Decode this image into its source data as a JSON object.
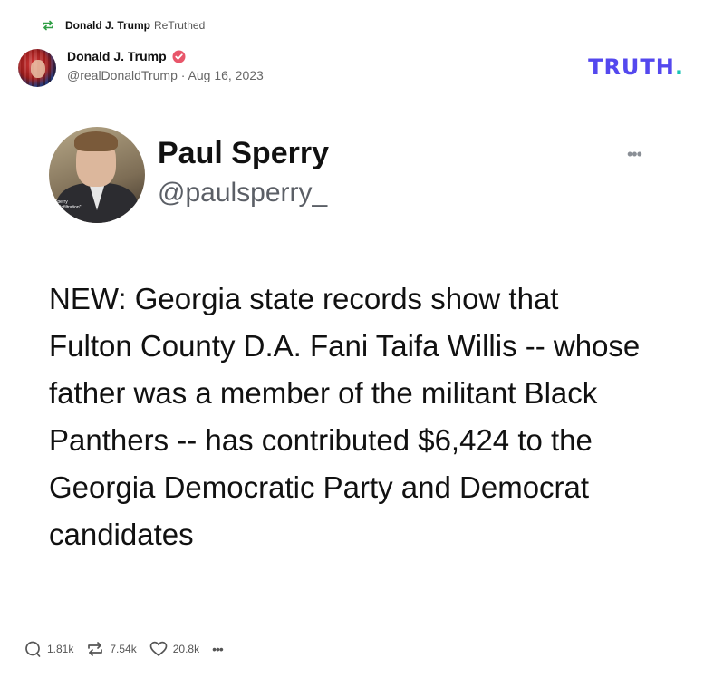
{
  "retruth": {
    "name": "Donald J. Trump",
    "suffix": "ReTruthed"
  },
  "post": {
    "author_name": "Donald J. Trump",
    "handle_date": "@realDonaldTrump · Aug 16, 2023",
    "verified": true
  },
  "brand": {
    "logo_text": "TRUTH",
    "logo_dot": ".",
    "accent": "#5448ee",
    "dot_color": "#18c4b5"
  },
  "embedded": {
    "name": "Paul Sperry",
    "handle": "@paulsperry_",
    "more": "•••",
    "avatar_caption_1": "Sperry",
    "avatar_caption_2": "r, \"Infiltration\"",
    "text": "NEW: Georgia state records show that Fulton County D.A. Fani Taifa Willis -- whose father was a member of the militant Black Panthers -- has contributed $6,424 to the Georgia Democratic Party and Democrat candidates"
  },
  "actions": {
    "replies": "1.81k",
    "retruths": "7.54k",
    "likes": "20.8k",
    "more": "•••"
  }
}
